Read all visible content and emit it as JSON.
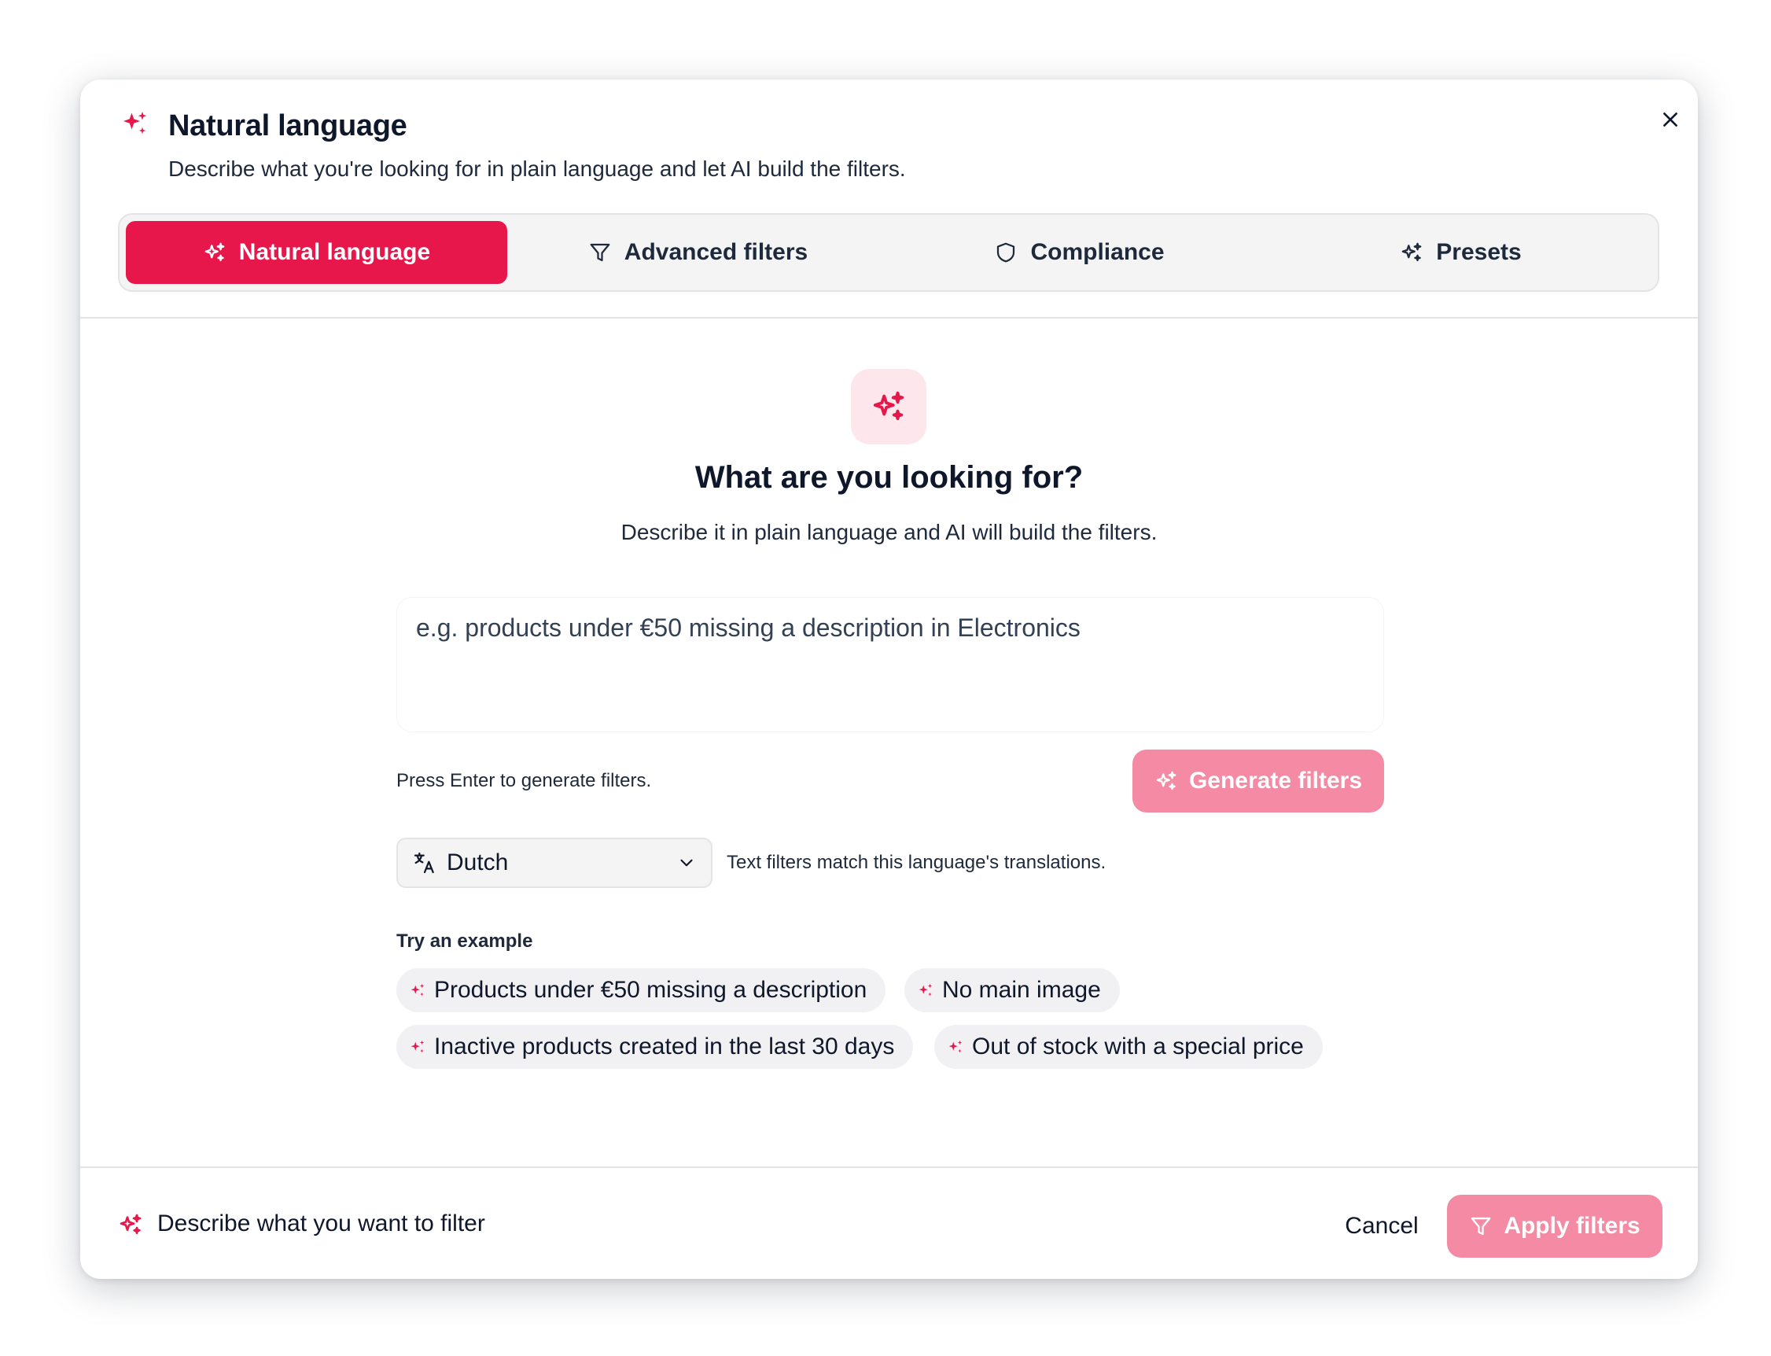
{
  "header": {
    "title": "Natural language",
    "subtitle": "Describe what you're looking for in plain language and let AI build the filters.",
    "icon": "sparkles-icon",
    "accent_color": "#e8174b"
  },
  "tabs": [
    {
      "label": "Natural language",
      "icon": "sparkles-icon",
      "active": true
    },
    {
      "label": "Advanced filters",
      "icon": "funnel-icon",
      "active": false
    },
    {
      "label": "Compliance",
      "icon": "shield-icon",
      "active": false
    },
    {
      "label": "Presets",
      "icon": "sparkles-icon",
      "active": false
    }
  ],
  "hero": {
    "title": "What are you looking for?",
    "subtitle": "Describe it in plain language and AI will build the filters."
  },
  "query": {
    "value": "",
    "placeholder": "e.g. products under €50 missing a description in Electronics"
  },
  "press_hint": "Press Enter to generate filters.",
  "generate_button": "Generate filters",
  "language": {
    "selected": "Dutch",
    "hint": "Text filters match this language's translations."
  },
  "examples": {
    "label": "Try an example",
    "items": [
      "Products under €50 missing a description",
      "No main image",
      "Inactive products created in the last 30 days",
      "Out of stock with a special price"
    ]
  },
  "footer": {
    "hint": "Describe what you want to filter",
    "cancel": "Cancel",
    "apply": "Apply filters"
  },
  "colors": {
    "primary": "#e8174b",
    "primary_disabled": "#f48aa3",
    "hero_bg": "#fde7ec"
  }
}
